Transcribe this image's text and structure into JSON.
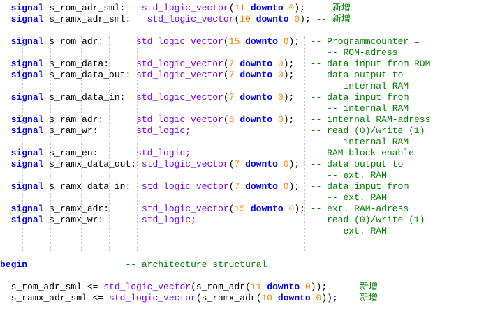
{
  "colors": {
    "keyword": "#0000ff",
    "type": "#8000ff",
    "number": "#ff8000",
    "comment": "#008000",
    "text": "#000000",
    "background": "#ffffff",
    "indent_guide": "#c8c8c8"
  },
  "code": {
    "lines": [
      {
        "row": 0,
        "tokens": [
          [
            "ws",
            "  "
          ],
          [
            "kw",
            "signal"
          ],
          [
            "id",
            " s_rom_adr_sml:   "
          ],
          [
            "ty",
            "std_logic_vector"
          ],
          [
            "pu",
            "("
          ],
          [
            "nu",
            "11"
          ],
          [
            "pu",
            " "
          ],
          [
            "kw",
            "downto"
          ],
          [
            "pu",
            " "
          ],
          [
            "nu",
            "0"
          ],
          [
            "pu",
            ");"
          ],
          [
            "ws",
            "  "
          ],
          [
            "cm",
            "-- 新增"
          ]
        ]
      },
      {
        "row": 1,
        "tokens": [
          [
            "ws",
            "  "
          ],
          [
            "kw",
            "signal"
          ],
          [
            "id",
            " s_ramx_adr_sml:   "
          ],
          [
            "ty",
            "std_logic_vector"
          ],
          [
            "pu",
            "("
          ],
          [
            "nu",
            "10"
          ],
          [
            "pu",
            " "
          ],
          [
            "kw",
            "downto"
          ],
          [
            "pu",
            " "
          ],
          [
            "nu",
            "0"
          ],
          [
            "pu",
            ");"
          ],
          [
            "ws",
            " "
          ],
          [
            "cm",
            "-- 新增"
          ]
        ]
      },
      {
        "row": 3,
        "tokens": [
          [
            "ws",
            "  "
          ],
          [
            "kw",
            "signal"
          ],
          [
            "id",
            " s_rom_adr:      "
          ],
          [
            "ty",
            "std_logic_vector"
          ],
          [
            "pu",
            "("
          ],
          [
            "nu",
            "15"
          ],
          [
            "pu",
            " "
          ],
          [
            "kw",
            "downto"
          ],
          [
            "pu",
            " "
          ],
          [
            "nu",
            "0"
          ],
          [
            "pu",
            ");"
          ],
          [
            "ws",
            "  "
          ],
          [
            "cm",
            "-- Programmcounter ="
          ]
        ]
      },
      {
        "row": 4,
        "tokens": [
          [
            "ws",
            "                                                            "
          ],
          [
            "cm",
            "-- ROM-adress"
          ]
        ]
      },
      {
        "row": 5,
        "tokens": [
          [
            "ws",
            "  "
          ],
          [
            "kw",
            "signal"
          ],
          [
            "id",
            " s_rom_data:     "
          ],
          [
            "ty",
            "std_logic_vector"
          ],
          [
            "pu",
            "("
          ],
          [
            "nu",
            "7"
          ],
          [
            "pu",
            " "
          ],
          [
            "kw",
            "downto"
          ],
          [
            "pu",
            " "
          ],
          [
            "nu",
            "0"
          ],
          [
            "pu",
            ");"
          ],
          [
            "ws",
            "   "
          ],
          [
            "cm",
            "-- data input from ROM"
          ]
        ]
      },
      {
        "row": 6,
        "tokens": [
          [
            "ws",
            "  "
          ],
          [
            "kw",
            "signal"
          ],
          [
            "id",
            " s_ram_data_out: "
          ],
          [
            "ty",
            "std_logic_vector"
          ],
          [
            "pu",
            "("
          ],
          [
            "nu",
            "7"
          ],
          [
            "pu",
            " "
          ],
          [
            "kw",
            "downto"
          ],
          [
            "pu",
            " "
          ],
          [
            "nu",
            "0"
          ],
          [
            "pu",
            ");"
          ],
          [
            "ws",
            "   "
          ],
          [
            "cm",
            "-- data output to"
          ]
        ]
      },
      {
        "row": 7,
        "tokens": [
          [
            "ws",
            "                                                            "
          ],
          [
            "cm",
            "-- internal RAM"
          ]
        ]
      },
      {
        "row": 8,
        "tokens": [
          [
            "ws",
            "  "
          ],
          [
            "kw",
            "signal"
          ],
          [
            "id",
            " s_ram_data_in:  "
          ],
          [
            "ty",
            "std_logic_vector"
          ],
          [
            "pu",
            "("
          ],
          [
            "nu",
            "7"
          ],
          [
            "pu",
            " "
          ],
          [
            "kw",
            "downto"
          ],
          [
            "pu",
            " "
          ],
          [
            "nu",
            "0"
          ],
          [
            "pu",
            ");"
          ],
          [
            "ws",
            "   "
          ],
          [
            "cm",
            "-- data input from"
          ]
        ]
      },
      {
        "row": 9,
        "tokens": [
          [
            "ws",
            "                                                            "
          ],
          [
            "cm",
            "-- internal RAM"
          ]
        ]
      },
      {
        "row": 10,
        "tokens": [
          [
            "ws",
            "  "
          ],
          [
            "kw",
            "signal"
          ],
          [
            "id",
            " s_ram_adr:      "
          ],
          [
            "ty",
            "std_logic_vector"
          ],
          [
            "pu",
            "("
          ],
          [
            "nu",
            "6"
          ],
          [
            "pu",
            " "
          ],
          [
            "kw",
            "downto"
          ],
          [
            "pu",
            " "
          ],
          [
            "nu",
            "0"
          ],
          [
            "pu",
            ");"
          ],
          [
            "ws",
            "   "
          ],
          [
            "cm",
            "-- internal RAM-adress"
          ]
        ]
      },
      {
        "row": 11,
        "tokens": [
          [
            "ws",
            "  "
          ],
          [
            "kw",
            "signal"
          ],
          [
            "id",
            " s_ram_wr:       "
          ],
          [
            "ty",
            "std_logic;"
          ],
          [
            "ws",
            "                      "
          ],
          [
            "cm",
            "-- read (0)/write (1)"
          ]
        ]
      },
      {
        "row": 12,
        "tokens": [
          [
            "ws",
            "                                                            "
          ],
          [
            "cm",
            "-- internal RAM"
          ]
        ]
      },
      {
        "row": 13,
        "tokens": [
          [
            "ws",
            "  "
          ],
          [
            "kw",
            "signal"
          ],
          [
            "id",
            " s_ram_en:       "
          ],
          [
            "ty",
            "std_logic;"
          ],
          [
            "ws",
            "                      "
          ],
          [
            "cm",
            "-- RAM-block enable"
          ]
        ]
      },
      {
        "row": 14,
        "tokens": [
          [
            "ws",
            "  "
          ],
          [
            "kw",
            "signal"
          ],
          [
            "id",
            " s_ramx_data_out: "
          ],
          [
            "ty",
            "std_logic_vector"
          ],
          [
            "pu",
            "("
          ],
          [
            "nu",
            "7"
          ],
          [
            "pu",
            " "
          ],
          [
            "kw",
            "downto"
          ],
          [
            "pu",
            " "
          ],
          [
            "nu",
            "0"
          ],
          [
            "pu",
            ");"
          ],
          [
            "ws",
            "  "
          ],
          [
            "cm",
            "-- data output to"
          ]
        ]
      },
      {
        "row": 15,
        "tokens": [
          [
            "ws",
            "                                                            "
          ],
          [
            "cm",
            "-- ext. RAM"
          ]
        ]
      },
      {
        "row": 16,
        "tokens": [
          [
            "ws",
            "  "
          ],
          [
            "kw",
            "signal"
          ],
          [
            "id",
            " s_ramx_data_in:  "
          ],
          [
            "ty",
            "std_logic_vector"
          ],
          [
            "pu",
            "("
          ],
          [
            "nu",
            "7"
          ],
          [
            "pu",
            " "
          ],
          [
            "kw",
            "downto"
          ],
          [
            "pu",
            " "
          ],
          [
            "nu",
            "0"
          ],
          [
            "pu",
            ");"
          ],
          [
            "ws",
            "  "
          ],
          [
            "cm",
            "-- data input from"
          ]
        ]
      },
      {
        "row": 17,
        "tokens": [
          [
            "ws",
            "                                                            "
          ],
          [
            "cm",
            "-- ext. RAM"
          ]
        ]
      },
      {
        "row": 18,
        "tokens": [
          [
            "ws",
            "  "
          ],
          [
            "kw",
            "signal"
          ],
          [
            "id",
            " s_ramx_adr:      "
          ],
          [
            "ty",
            "std_logic_vector"
          ],
          [
            "pu",
            "("
          ],
          [
            "nu",
            "15"
          ],
          [
            "pu",
            " "
          ],
          [
            "kw",
            "downto"
          ],
          [
            "pu",
            " "
          ],
          [
            "nu",
            "0"
          ],
          [
            "pu",
            ");"
          ],
          [
            "ws",
            " "
          ],
          [
            "cm",
            "-- ext. RAM-adress"
          ]
        ]
      },
      {
        "row": 19,
        "tokens": [
          [
            "ws",
            "  "
          ],
          [
            "kw",
            "signal"
          ],
          [
            "id",
            " s_ramx_wr:       "
          ],
          [
            "ty",
            "std_logic;"
          ],
          [
            "ws",
            "                     "
          ],
          [
            "cm",
            "-- read (0)/write (1)"
          ]
        ]
      },
      {
        "row": 20,
        "tokens": [
          [
            "ws",
            "                                                            "
          ],
          [
            "cm",
            "-- ext. RAM"
          ]
        ]
      },
      {
        "row": 23,
        "tokens": [
          [
            "kw",
            "begin"
          ],
          [
            "ws",
            "                  "
          ],
          [
            "cm",
            "-- architecture structural"
          ]
        ]
      },
      {
        "row": 25,
        "tokens": [
          [
            "ws",
            "  "
          ],
          [
            "id",
            "s_rom_adr_sml <= "
          ],
          [
            "ty",
            "std_logic_vector"
          ],
          [
            "pu",
            "(s_rom_adr("
          ],
          [
            "nu",
            "11"
          ],
          [
            "pu",
            " "
          ],
          [
            "kw",
            "downto"
          ],
          [
            "pu",
            " "
          ],
          [
            "nu",
            "0"
          ],
          [
            "pu",
            "));"
          ],
          [
            "ws",
            "    "
          ],
          [
            "cm",
            "--新增"
          ]
        ]
      },
      {
        "row": 26,
        "tokens": [
          [
            "ws",
            "  "
          ],
          [
            "id",
            "s_ramx_adr_sml <= "
          ],
          [
            "ty",
            "std_logic_vector"
          ],
          [
            "pu",
            "(s_ramx_adr("
          ],
          [
            "nu",
            "10"
          ],
          [
            "pu",
            " "
          ],
          [
            "kw",
            "downto"
          ],
          [
            "pu",
            " "
          ],
          [
            "nu",
            "0"
          ],
          [
            "pu",
            "));"
          ],
          [
            "ws",
            "  "
          ],
          [
            "cm",
            "--新增"
          ]
        ]
      }
    ]
  }
}
